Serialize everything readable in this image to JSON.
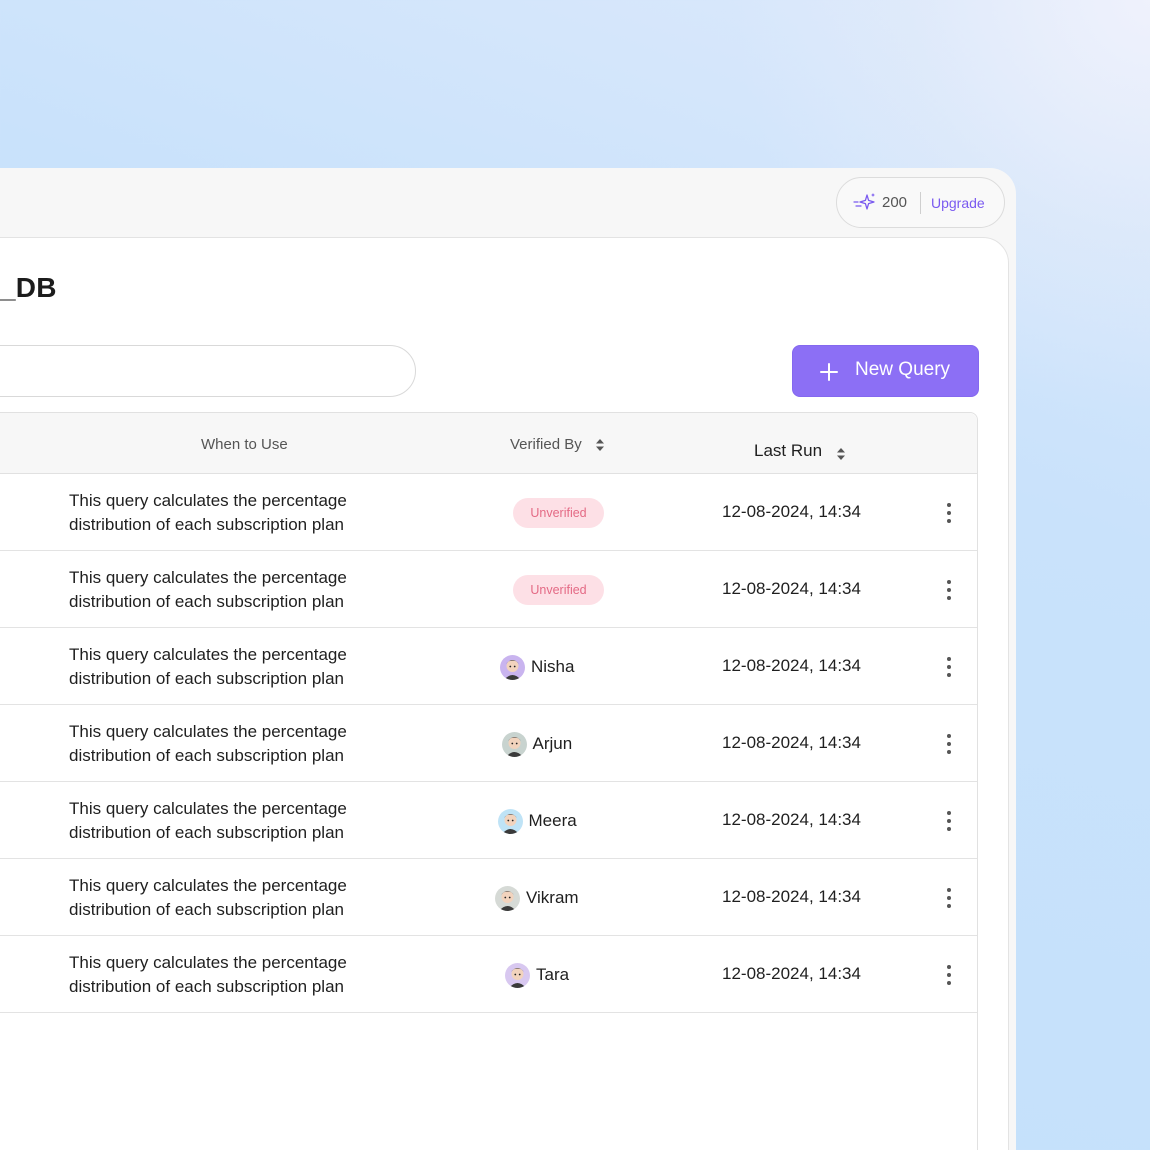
{
  "credits": {
    "count": "200",
    "upgrade_label": "Upgrade",
    "accent": "#7a5af0"
  },
  "page": {
    "title": "_DB"
  },
  "toolbar": {
    "new_query_label": "New Query",
    "button_color": "#8c6ff5"
  },
  "table": {
    "columns": {
      "when_to_use": "When to Use",
      "verified_by": "Verified By",
      "last_run": "Last Run"
    },
    "rows": [
      {
        "description_line1": "This query calculates the percentage",
        "description_line2": "distribution of each subscription plan",
        "verified": false,
        "status": "Unverified",
        "last_run": "12-08-2024, 14:34"
      },
      {
        "description_line1": "This query calculates the percentage",
        "description_line2": "distribution of each subscription plan",
        "verified": false,
        "status": "Unverified",
        "last_run": "12-08-2024, 14:34"
      },
      {
        "description_line1": "This query calculates the percentage",
        "description_line2": "distribution of each subscription plan",
        "verified": true,
        "verifier": "Nisha",
        "avatar_color": "#c9b4ef",
        "last_run": "12-08-2024, 14:34"
      },
      {
        "description_line1": "This query calculates the percentage",
        "description_line2": "distribution of each subscription plan",
        "verified": true,
        "verifier": "Arjun",
        "avatar_color": "#c8d3cf",
        "last_run": "12-08-2024, 14:34"
      },
      {
        "description_line1": "This query calculates the percentage",
        "description_line2": "distribution of each subscription plan",
        "verified": true,
        "verifier": "Meera",
        "avatar_color": "#bfe3f6",
        "last_run": "12-08-2024, 14:34"
      },
      {
        "description_line1": "This query calculates the percentage",
        "description_line2": "distribution of each subscription plan",
        "verified": true,
        "verifier": "Vikram",
        "avatar_color": "#d6dad6",
        "last_run": "12-08-2024, 14:34"
      },
      {
        "description_line1": "This query calculates the percentage",
        "description_line2": "distribution of each subscription plan",
        "verified": true,
        "verifier": "Tara",
        "avatar_color": "#d8c8f0",
        "last_run": "12-08-2024, 14:34"
      }
    ]
  },
  "unverified_badge": {
    "bg": "#fde0e6",
    "fg": "#e46a85"
  }
}
